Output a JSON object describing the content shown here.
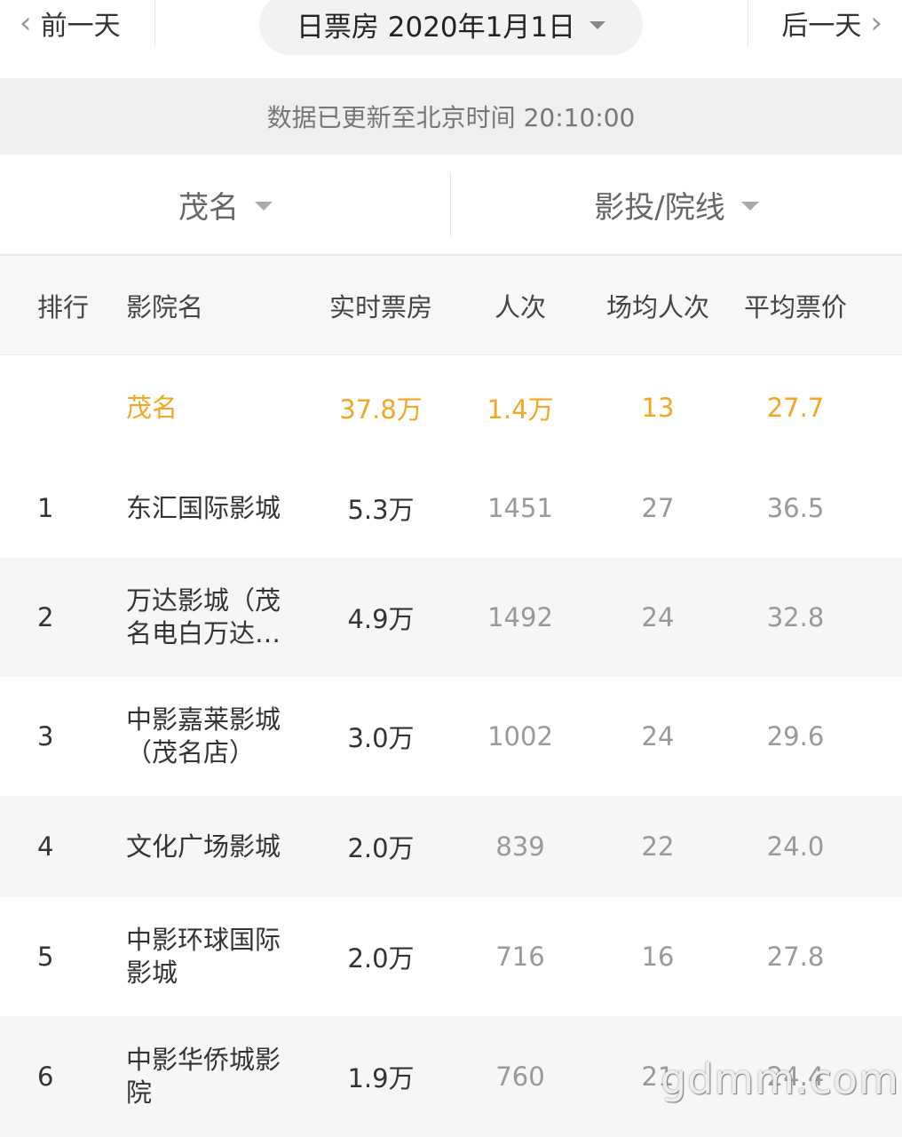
{
  "nav": {
    "prev_label": "前一天",
    "next_label": "后一天",
    "date_label": "日票房 2020年1月1日"
  },
  "notice": "数据已更新至北京时间 20:10:00",
  "filters": {
    "city": "茂名",
    "group": "影投/院线"
  },
  "columns": [
    "排行",
    "影院名",
    "实时票房",
    "人次",
    "场均人次",
    "平均票价"
  ],
  "summary": {
    "name": "茂名",
    "box_office": "37.8万",
    "people": "1.4万",
    "avg_per_show": "13",
    "avg_price": "27.7"
  },
  "rows": [
    {
      "rank": "1",
      "name": [
        "东汇国际影城"
      ],
      "box_office": "5.3万",
      "people": "1451",
      "avg_per_show": "27",
      "avg_price": "36.5"
    },
    {
      "rank": "2",
      "name": [
        "万达影城（茂",
        "名电白万达…"
      ],
      "box_office": "4.9万",
      "people": "1492",
      "avg_per_show": "24",
      "avg_price": "32.8"
    },
    {
      "rank": "3",
      "name": [
        "中影嘉莱影城",
        "（茂名店）"
      ],
      "box_office": "3.0万",
      "people": "1002",
      "avg_per_show": "24",
      "avg_price": "29.6"
    },
    {
      "rank": "4",
      "name": [
        "文化广场影城"
      ],
      "box_office": "2.0万",
      "people": "839",
      "avg_per_show": "22",
      "avg_price": "24.0"
    },
    {
      "rank": "5",
      "name": [
        "中影环球国际",
        "影城"
      ],
      "box_office": "2.0万",
      "people": "716",
      "avg_per_show": "16",
      "avg_price": "27.8"
    },
    {
      "rank": "6",
      "name": [
        "中影华侨城影",
        "院"
      ],
      "box_office": "1.9万",
      "people": "760",
      "avg_per_show": "21",
      "avg_price": "24.4"
    }
  ],
  "watermark": "gdmm.com",
  "colors": {
    "highlight": "#f5a623",
    "muted": "#999999",
    "stripe": "#f6f6f6"
  }
}
